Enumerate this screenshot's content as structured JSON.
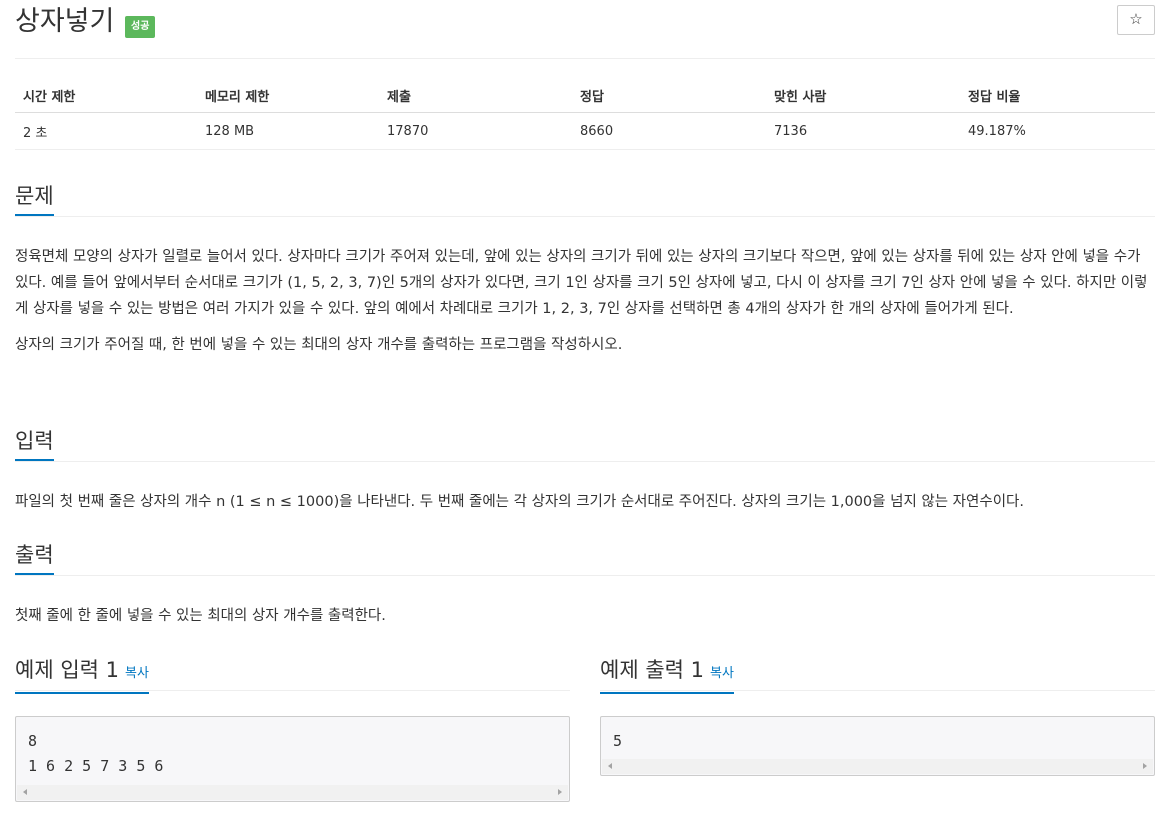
{
  "problem": {
    "title": "상자넣기",
    "badge": "성공",
    "star_icon": "☆"
  },
  "info": {
    "headers": [
      "시간 제한",
      "메모리 제한",
      "제출",
      "정답",
      "맞힌 사람",
      "정답 비율"
    ],
    "values": [
      "2 초",
      "128 MB",
      "17870",
      "8660",
      "7136",
      "49.187%"
    ]
  },
  "sections": {
    "description": {
      "heading": "문제",
      "paragraphs": [
        "정육면체 모양의 상자가 일렬로 늘어서 있다. 상자마다 크기가 주어져 있는데, 앞에 있는 상자의 크기가 뒤에 있는 상자의 크기보다 작으면, 앞에 있는 상자를 뒤에 있는 상자 안에 넣을 수가 있다. 예를 들어 앞에서부터 순서대로 크기가 (1, 5, 2, 3, 7)인 5개의 상자가 있다면, 크기 1인 상자를 크기 5인 상자에 넣고, 다시 이 상자를 크기 7인 상자 안에 넣을 수 있다. 하지만 이렇게 상자를 넣을 수 있는 방법은 여러 가지가 있을 수 있다. 앞의 예에서 차례대로 크기가 1, 2, 3, 7인 상자를 선택하면 총 4개의 상자가 한 개의 상자에 들어가게 된다.",
        "상자의 크기가 주어질 때, 한 번에 넣을 수 있는 최대의 상자 개수를 출력하는 프로그램을 작성하시오."
      ]
    },
    "input": {
      "heading": "입력",
      "text": "파일의 첫 번째 줄은 상자의 개수 n (1 ≤ n ≤ 1000)을 나타낸다. 두 번째 줄에는 각 상자의 크기가 순서대로 주어진다. 상자의 크기는 1,000을 넘지 않는 자연수이다."
    },
    "output": {
      "heading": "출력",
      "text": "첫째 줄에 한 줄에 넣을 수 있는 최대의 상자 개수를 출력한다."
    }
  },
  "samples": {
    "input": {
      "heading": "예제 입력 1",
      "copy_label": "복사",
      "content": "8\n1 6 2 5 7 3 5 6"
    },
    "output": {
      "heading": "예제 출력 1",
      "copy_label": "복사",
      "content": "5"
    }
  }
}
